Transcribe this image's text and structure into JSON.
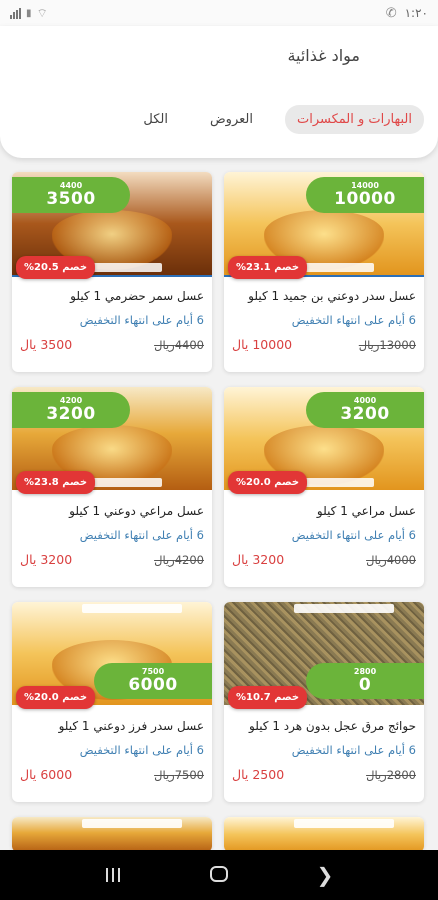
{
  "status_bar": {
    "time": "١:٢٠"
  },
  "header": {
    "title": "مواد غذائية",
    "tabs": [
      {
        "label": "الكل",
        "active": false
      },
      {
        "label": "العروض",
        "active": false
      },
      {
        "label": "البهارات و المكسرات",
        "active": true
      }
    ]
  },
  "products": [
    {
      "name": "عسل سدر دوعني بن جميد 1 كيلو",
      "banner_old": "14000",
      "banner_new": "10000",
      "discount": "خصم 23.1%",
      "remaining": "6 أيام على انتهاء التخفيض",
      "old_price": "13000ريال",
      "new_price": "10000 يال"
    },
    {
      "name": "عسل سمر حضرمي 1 كيلو",
      "banner_old": "4400",
      "banner_new": "3500",
      "discount": "خصم 20.5%",
      "remaining": "6 أيام على انتهاء التخفيض",
      "old_price": "4400ريال",
      "new_price": "3500 يال"
    },
    {
      "name": "عسل مراعي 1 كيلو",
      "banner_old": "4000",
      "banner_new": "3200",
      "discount": "خصم 20.0%",
      "remaining": "6 أيام على انتهاء التخفيض",
      "old_price": "4000ريال",
      "new_price": "3200 يال"
    },
    {
      "name": "عسل مراعي دوعني 1 كيلو",
      "banner_old": "4200",
      "banner_new": "3200",
      "discount": "خصم 23.8%",
      "remaining": "6 أيام على انتهاء التخفيض",
      "old_price": "4200ريال",
      "new_price": "3200 يال"
    },
    {
      "name": "حوائج مرق عجل بدون هرد 1 كيلو",
      "banner_old": "2800",
      "banner_new": "0",
      "discount": "خصم 10.7%",
      "remaining": "6 أيام على انتهاء التخفيض",
      "old_price": "2800ريال",
      "new_price": "2500 يال"
    },
    {
      "name": "عسل سدر فرز دوعني 1 كيلو",
      "banner_old": "7500",
      "banner_new": "6000",
      "discount": "خصم 20.0%",
      "remaining": "6 أيام على انتهاء التخفيض",
      "old_price": "7500ريال",
      "new_price": "6000 يال"
    }
  ],
  "colors": {
    "accent_red": "#e23636",
    "banner_green": "#6bb43a",
    "link_blue": "#3f7fb2"
  },
  "nav": {
    "recents_icon": "recents-icon",
    "home_icon": "home-icon",
    "back_icon": "back-icon"
  }
}
